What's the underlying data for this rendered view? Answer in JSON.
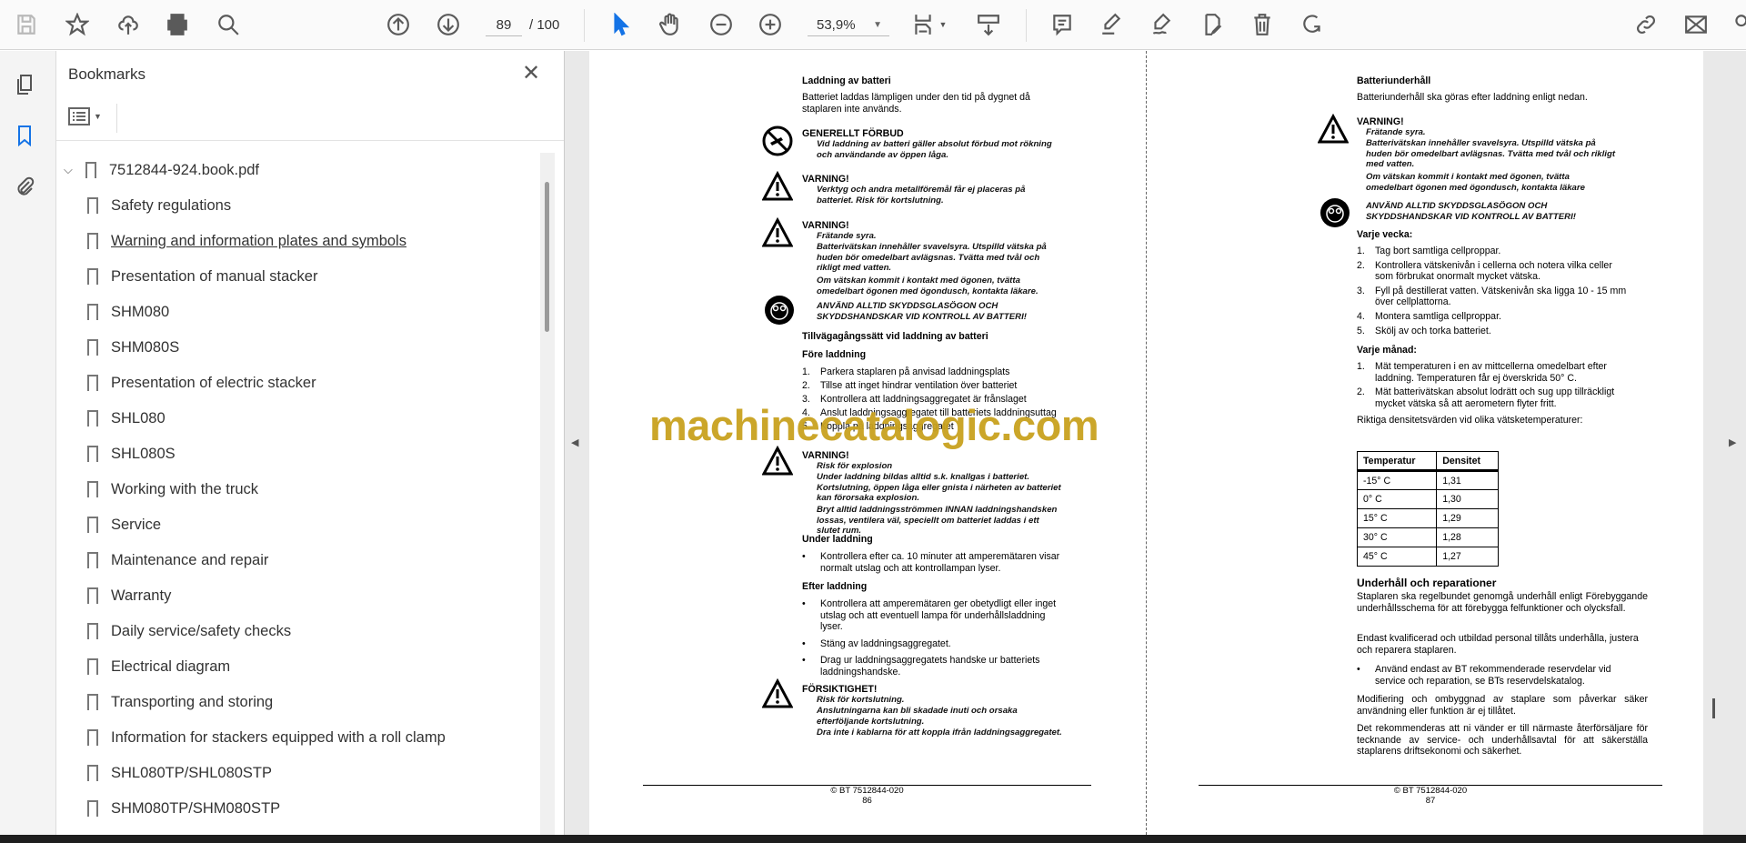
{
  "toolbar": {
    "page_current": "89",
    "page_total": "/ 100",
    "zoom": "53,9%"
  },
  "bookmarks": {
    "title": "Bookmarks",
    "root": "7512844-924.book.pdf",
    "items": [
      "Safety regulations",
      "Warning and information plates and symbols",
      "Presentation of manual stacker",
      "SHM080",
      "SHM080S",
      "Presentation of electric stacker",
      "SHL080",
      "SHL080S",
      "Working with the truck",
      "Service",
      "Maintenance and repair",
      "Warranty",
      "Daily service/safety checks",
      "Electrical diagram",
      "Transporting and storing",
      "Information for stackers equipped with a roll clamp",
      "SHL080TP/SHL080STP",
      "SHM080TP/SHM080STP"
    ]
  },
  "watermark": "machinecatalogic.com",
  "left_page": {
    "title": "Laddning av batteri",
    "intro": "Batteriet laddas lämpligen under den tid på dygnet då staplaren inte används.",
    "w1_title": "GENERELLT FÖRBUD",
    "w1_text": "Vid laddning av batteri gäller absolut förbud mot rökning och användande av öppen låga.",
    "w2_title": "VARNING!",
    "w2_text": "Verktyg och andra metallföremål får ej placeras på batteriet. Risk för kortslutning.",
    "w3_title": "VARNING!",
    "w3_l1": "Frätande syra.",
    "w3_l2": "Batterivätskan innehåller svavelsyra. Utspilld vätska på huden bör omedelbart avlägsnas. Tvätta med tvål och rikligt med vatten.",
    "w3_l3": "Om vätskan kommit i kontakt med ögonen, tvätta omedelbart ögonen med ögondusch, kontakta läkare.",
    "w3_l4": "ANVÄND ALLTID SKYDDSGLASÖGON OCH SKYDDSHANDSKAR VID KONTROLL AV BATTERI!",
    "h2": "Tillvägagångssätt vid laddning av batteri",
    "h3": "Före laddning",
    "steps": [
      "Parkera staplaren på anvisad laddningsplats",
      "Tillse att inget hindrar ventilation över batteriet",
      "Kontrollera att laddningsaggregatet är frånslaget",
      "Anslut laddningsaggregatet till batteriets laddningsuttag",
      "Koppla på laddningsaggregatet"
    ],
    "w4_title": "VARNING!",
    "w4_l1": "Risk för explosion",
    "w4_l2": "Under laddning bildas alltid s.k. knallgas i batteriet. Kortslutning, öppen låga eller gnista i närheten av batteriet kan förorsaka explosion.",
    "w4_l3": "Bryt alltid laddningsströmmen INNAN laddningshandsken lossas, ventilera väl, speciellt om batteriet laddas i ett slutet rum.",
    "under_title": "Under laddning",
    "under_items": [
      "Kontrollera efter ca. 10 minuter att amperemätaren visar normalt utslag och att kontrollampan lyser."
    ],
    "efter_title": "Efter laddning",
    "efter_items": [
      "Kontrollera att amperemätaren ger obetydligt eller inget utslag och att eventuell lampa för underhållsladdning lyser.",
      "Stäng av laddningsaggregatet.",
      "Drag ur laddningsaggregatets handske ur batteriets laddningshandske."
    ],
    "w5_title": "FÖRSIKTIGHET!",
    "w5_l1": "Risk för kortslutning.",
    "w5_l2": "Anslutningarna kan bli skadade inuti och orsaka efterföljande kortslutning.",
    "w5_l3": "Dra inte i kablarna för att koppla ifrån laddningsaggregatet.",
    "footer": "© BT 7512844-020",
    "page_no": "86"
  },
  "right_page": {
    "title": "Batteriunderhåll",
    "intro": "Batteriunderhåll ska göras efter laddning enligt nedan.",
    "w1_title": "VARNING!",
    "w1_l1": "Frätande syra.",
    "w1_l2": "Batterivätskan innehåller svavelsyra. Utspilld vätska på huden bör omedelbart avlägsnas. Tvätta med tvål och rikligt med vatten.",
    "w1_l3": "Om vätskan kommit i kontakt med ögonen, tvätta omedelbart ögonen med ögondusch, kontakta läkare",
    "w1_l4": "ANVÄND ALLTID SKYDDSGLASÖGON OCH SKYDDSHANDSKAR VID KONTROLL AV BATTERI!",
    "vecka_title": "Varje vecka:",
    "vecka": [
      "Tag bort samtliga cellproppar.",
      "Kontrollera vätskenivån i cellerna och notera vilka celler som förbrukat onormalt mycket vätska.",
      "Fyll på destillerat vatten. Vätskenivån ska ligga 10 - 15 mm över cellplattorna.",
      "Montera samtliga cellproppar.",
      "Skölj av och torka batteriet."
    ],
    "manad_title": "Varje månad:",
    "manad": [
      "Mät temperaturen i en av mittcellerna omedelbart efter laddning. Temperaturen får ej överskrida 50° C.",
      "Mät batterivätskan absolut lodrätt och sug upp tillräckligt mycket vätska så att aerometern flyter fritt."
    ],
    "table_intro": "Riktiga densitetsvärden vid olika vätsketemperaturer:",
    "table": {
      "headers": [
        "Temperatur",
        "Densitet"
      ],
      "rows": [
        [
          "-15° C",
          "1,31"
        ],
        [
          "0° C",
          "1,30"
        ],
        [
          "15° C",
          "1,29"
        ],
        [
          "30° C",
          "1,28"
        ],
        [
          "45° C",
          "1,27"
        ]
      ]
    },
    "h2": "Underhåll och reparationer",
    "p1": "Staplaren ska regelbundet genomgå underhåll enligt Förebyggande underhållsschema för att förebygga felfunktioner och olycksfall.",
    "p2": "Endast kvalificerad och utbildad personal tillåts underhålla, justera och reparera staplaren.",
    "bullet": "Använd endast av BT rekommenderade reservdelar vid service och reparation, se BTs reservdelskatalog.",
    "p3": "Modifiering och ombyggnad av staplare som påverkar säker användning eller funktion är ej tillåtet.",
    "p4": "Det rekommenderas att ni vänder er till närmaste återförsäljare för tecknande av service- och underhållsavtal för att säkerställa staplarens driftsekonomi och säkerhet.",
    "footer": "© BT 7512844-020",
    "page_no": "87"
  }
}
